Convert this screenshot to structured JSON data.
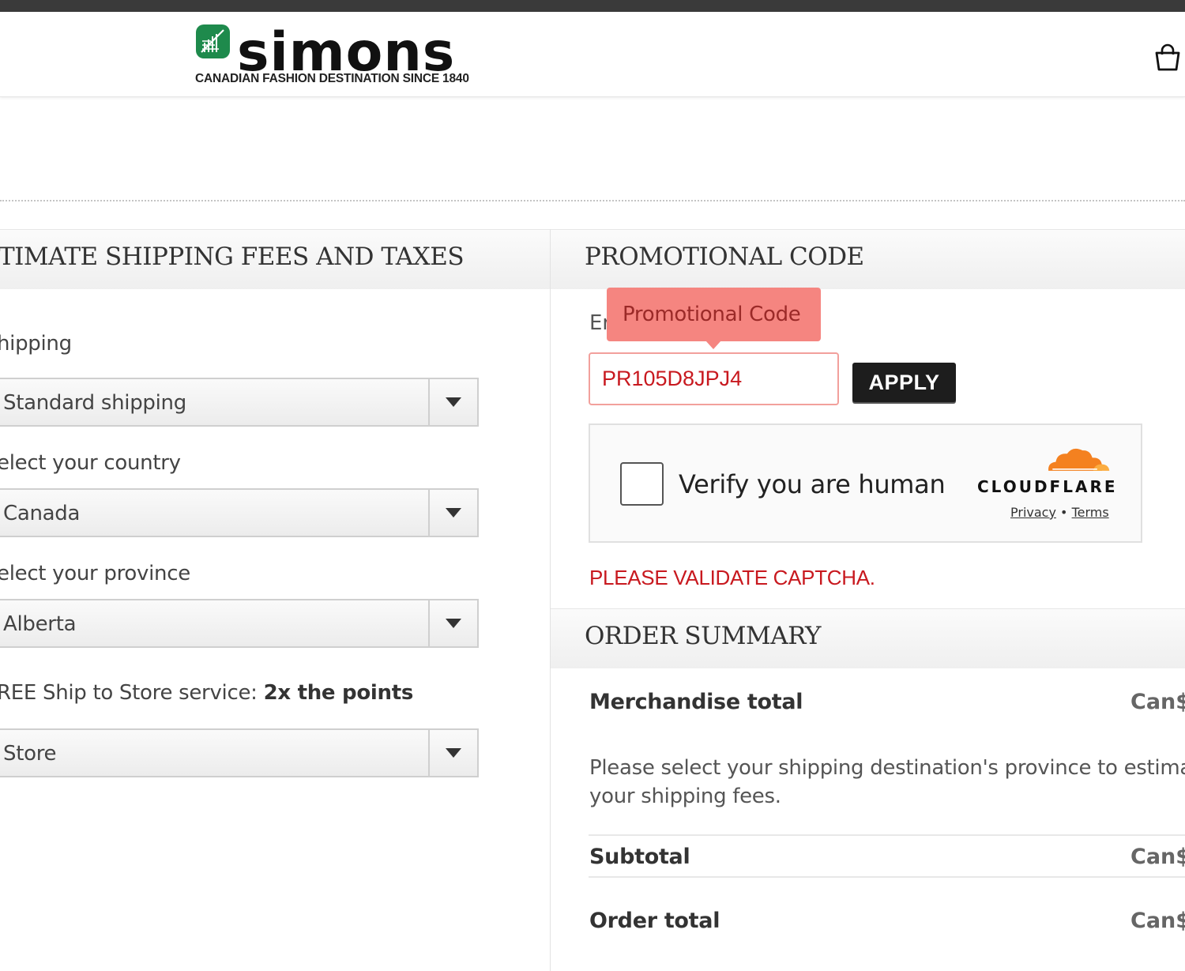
{
  "brand": {
    "name": "simons",
    "tagline": "CANADIAN FASHION DESTINATION SINCE 1840",
    "logo_color": "#1e8a4c"
  },
  "header": {
    "cart_icon": "shopping-bag-icon"
  },
  "shipping_section": {
    "title": "TIMATE SHIPPING FEES AND TAXES",
    "shipping_label": "hipping",
    "shipping_value": "Standard shipping",
    "country_label": "elect your country",
    "country_value": "Canada",
    "province_label": "elect your province",
    "province_value": "Alberta",
    "store_label_prefix": "REE Ship to Store service: ",
    "store_label_bold": "2x the points",
    "store_value": "Store"
  },
  "promo_section": {
    "title": "PROMOTIONAL CODE",
    "field_prefix": "Er",
    "tooltip": "Promotional Code",
    "input_value": "PR105D8JPJ4",
    "apply_label": "APPLY",
    "captcha_text": "Verify you are human",
    "captcha_brand": "CLOUDFLARE",
    "privacy_link": "Privacy",
    "terms_link": "Terms",
    "link_separator": "•",
    "error": "PLEASE VALIDATE CAPTCHA."
  },
  "order_summary": {
    "title": "ORDER SUMMARY",
    "merch_label": "Merchandise total",
    "merch_value": "Can$",
    "note": "Please select your shipping destination's province to estimate your shipping fees.",
    "subtotal_label": "Subtotal",
    "subtotal_value": "Can$",
    "total_label": "Order total",
    "total_value": "Can$"
  },
  "colors": {
    "error": "#c8191f",
    "tooltip_bg": "#f58580",
    "cloudflare_orange": "#f48120"
  }
}
